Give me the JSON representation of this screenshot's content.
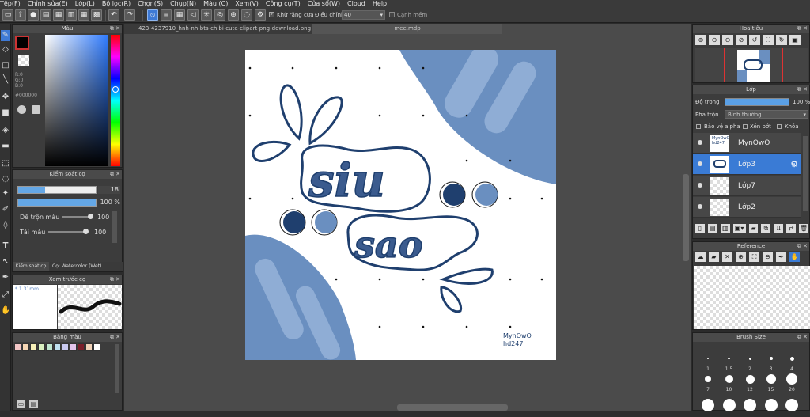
{
  "menu": [
    "Tệp(F)",
    "Chỉnh sửa(E)",
    "Lớp(L)",
    "Bộ lọc(R)",
    "Chọn(S)",
    "Chụp(N)",
    "Màu (C)",
    "Xem(V)",
    "Công cụ(T)",
    "Cửa sổ(W)",
    "Cloud",
    "Help"
  ],
  "toolbar": {
    "antialias_label": "Khử răng cưa",
    "adjust_label": "Điều chỉnh",
    "adjust_value": "40",
    "edge_label": "Cạnh mềm"
  },
  "color_panel": {
    "title": "Màu",
    "r": "R:0",
    "g": "G:0",
    "b": "B:0",
    "hex": "#000000"
  },
  "brush_control": {
    "title": "Kiểm soát cọ",
    "size_value": "18",
    "opacity_value": "100 %",
    "blend_label": "Dễ trộn màu",
    "blend_value": "100",
    "reload_label": "Tải màu",
    "reload_value": "100",
    "tab1": "Kiểm soát cọ",
    "tab2": "Cọ: Watercolor (Wet)"
  },
  "brush_preview": {
    "title": "Xem trước cọ",
    "size_text": "* 1.31mm"
  },
  "palette": {
    "title": "Bảng màu",
    "swatches": [
      "#f3c6c6",
      "#f6d6b4",
      "#f7f0b8",
      "#d9f0c0",
      "#bfe6cf",
      "#bfe0ef",
      "#c8c8ef",
      "#e4c4ec",
      "#7a1f2a",
      "#f0d2b8",
      "#ffffff"
    ]
  },
  "tabs": {
    "tab1": "423-4237910_hnh-nh-bts-chibi-cute-clipart-png-download.png",
    "tab2": "mee.mdp"
  },
  "artwork": {
    "signature_line1": "MynOwO",
    "signature_line2": "hd247"
  },
  "navigator": {
    "title": "Hoa tiêu"
  },
  "layers": {
    "title": "Lớp",
    "opacity_label": "Độ trong",
    "opacity_value": "100 %",
    "blend_label": "Pha trộn",
    "blend_value": "Bình thường",
    "protect_alpha": "Bảo vệ alpha",
    "clipping": "Xén bớt",
    "lock": "Khóa",
    "items": [
      {
        "name": "MynOwO",
        "thumb_text": "MynOwO hd247"
      },
      {
        "name": "Lớp3"
      },
      {
        "name": "Lớp7"
      },
      {
        "name": "Lớp2"
      }
    ]
  },
  "reference": {
    "title": "Reference"
  },
  "brush_size": {
    "title": "Brush Size",
    "sizes": [
      "1",
      "1.5",
      "2",
      "3",
      "4",
      "7",
      "10",
      "12",
      "15",
      "20"
    ]
  },
  "colors": {
    "accent": "#3a7bd5",
    "art_dark": "#1f3f6e",
    "art_mid": "#6a8fc0",
    "art_light": "#a9c2e3"
  }
}
